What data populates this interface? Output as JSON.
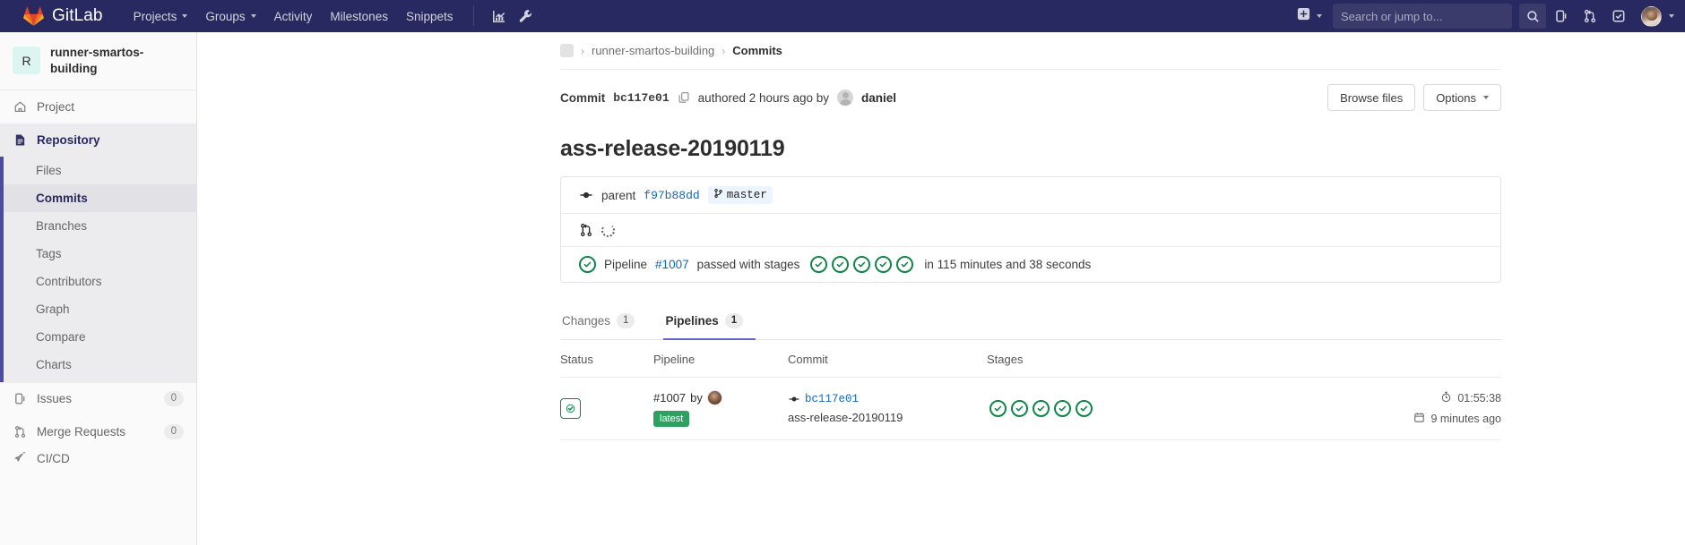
{
  "navbar": {
    "brand": "GitLab",
    "links": [
      {
        "label": "Projects",
        "caret": true
      },
      {
        "label": "Groups",
        "caret": true
      },
      {
        "label": "Activity",
        "caret": false
      },
      {
        "label": "Milestones",
        "caret": false
      },
      {
        "label": "Snippets",
        "caret": false
      }
    ],
    "icons": [
      {
        "name": "analytics-chart-icon"
      },
      {
        "name": "wrench-admin-icon"
      }
    ],
    "create_icon": "plus-square-icon",
    "search": {
      "placeholder": "Search or jump to...",
      "value": "",
      "icon": "search-icon"
    },
    "right_icons": [
      {
        "name": "search-icon"
      },
      {
        "name": "issues-icon"
      },
      {
        "name": "merge-requests-icon"
      },
      {
        "name": "todos-icon"
      }
    ],
    "avatar": "user-avatar"
  },
  "sidebar": {
    "project": {
      "initial": "R",
      "name": "runner-smartos-building"
    },
    "top_item": {
      "label": "Project",
      "icon": "home-icon"
    },
    "repository": {
      "label": "Repository",
      "icon": "file-doc-icon"
    },
    "sub_items": [
      {
        "label": "Files",
        "active": false
      },
      {
        "label": "Commits",
        "active": true
      },
      {
        "label": "Branches",
        "active": false
      },
      {
        "label": "Tags",
        "active": false
      },
      {
        "label": "Contributors",
        "active": false
      },
      {
        "label": "Graph",
        "active": false
      },
      {
        "label": "Compare",
        "active": false
      },
      {
        "label": "Charts",
        "active": false
      }
    ],
    "items": [
      {
        "label": "Issues",
        "icon": "issues-icon",
        "count": "0"
      },
      {
        "label": "Merge Requests",
        "icon": "merge-requests-icon",
        "count": "0"
      },
      {
        "label": "CI/CD",
        "icon": "rocket-icon",
        "count": ""
      }
    ]
  },
  "breadcrumb": {
    "project": "runner-smartos-building",
    "current": "Commits"
  },
  "commit_header": {
    "label": "Commit",
    "sha": "bc117e01",
    "copy_icon": "copy-icon",
    "authored_text": "authored 2 hours ago by",
    "author": "daniel",
    "browse_files": "Browse files",
    "options": "Options"
  },
  "commit_title": "ass-release-20190119",
  "info": {
    "parent_label": "parent",
    "parent_sha": "f97b88dd",
    "branch": "master",
    "branch_icon": "branch-icon",
    "commit-node-icon": "commit-node-icon",
    "mr_icon": "merge-request-icon",
    "spinner": "loading-spinner"
  },
  "pipeline_summary": {
    "prefix": "Pipeline",
    "id": "#1007",
    "middle": "passed with stages",
    "stages": 5,
    "duration_text": "in 115 minutes and 38 seconds"
  },
  "tabs": [
    {
      "label": "Changes",
      "count": "1",
      "active": false
    },
    {
      "label": "Pipelines",
      "count": "1",
      "active": true
    }
  ],
  "table": {
    "headers": [
      "Status",
      "Pipeline",
      "Commit",
      "Stages"
    ],
    "rows": [
      {
        "status": "passed",
        "status_icon": "status-passed-icon",
        "pipeline_id": "#1007",
        "pipeline_by": "by",
        "pipeline_avatar": "user-avatar",
        "latest_badge": "latest",
        "commit_sha": "bc117e01",
        "commit_icon": "commit-node-icon",
        "commit_message": "ass-release-20190119",
        "stages": 5,
        "duration": "01:55:38",
        "duration_icon": "timer-icon",
        "finished": "9 minutes ago",
        "finished_icon": "calendar-icon"
      }
    ]
  },
  "colors": {
    "brand_navy": "#292961",
    "accent_purple": "#6666c4",
    "success_green": "#108548",
    "link_blue": "#1068bf",
    "badge_green": "#2da160"
  }
}
